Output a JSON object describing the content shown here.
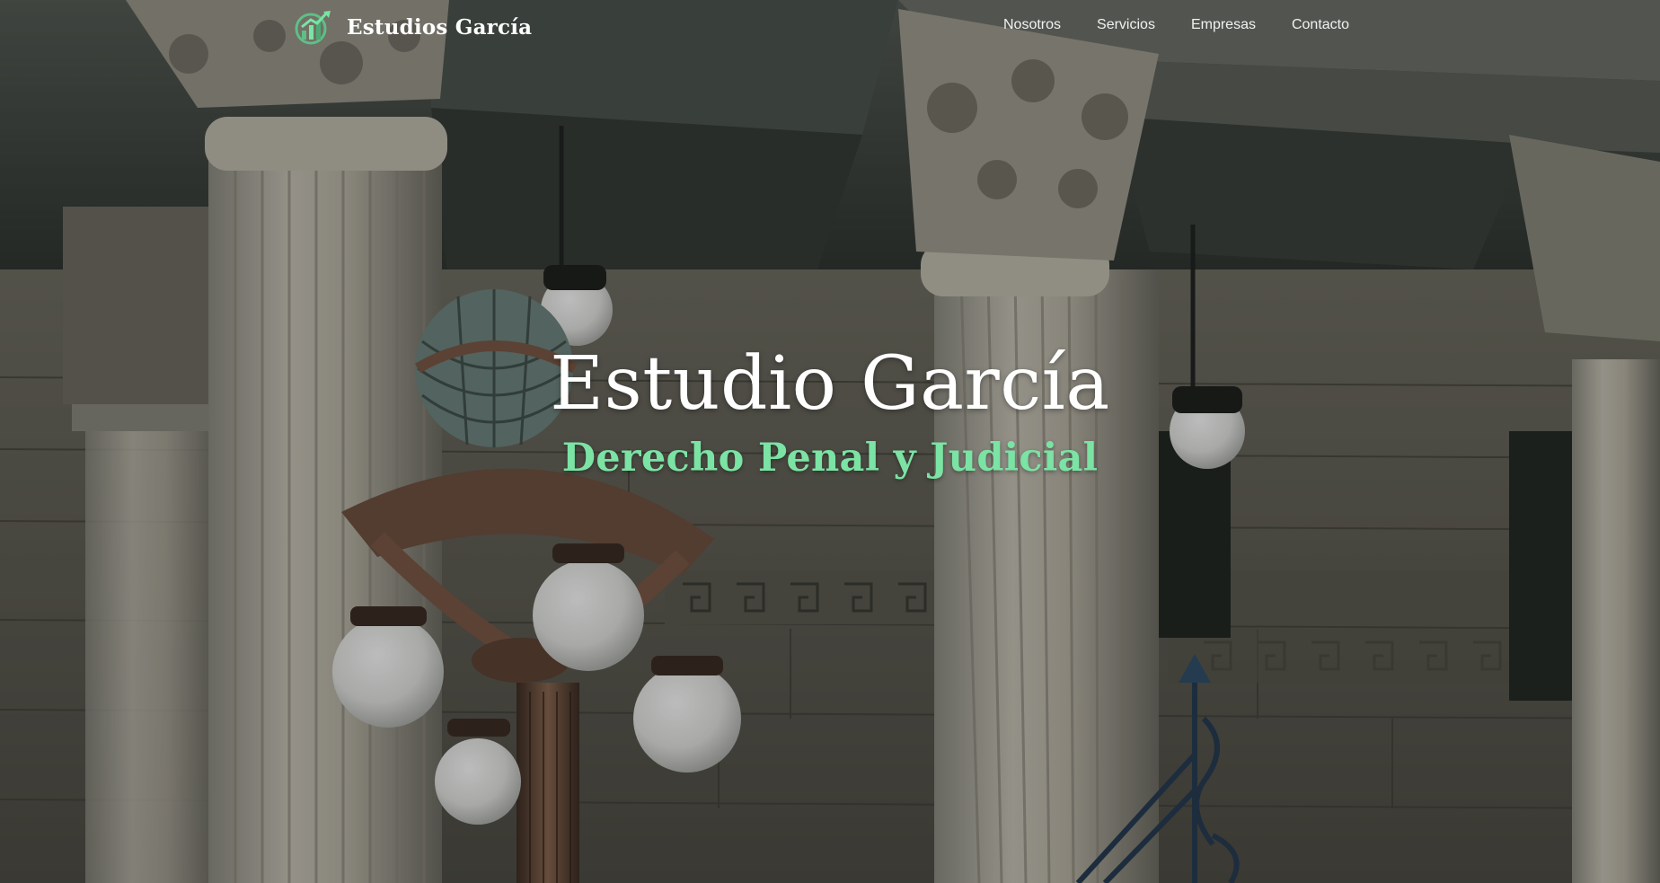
{
  "nav": {
    "brand_name": "Estudios García",
    "brand_icon": "growth-chart-icon",
    "links": [
      "Nosotros",
      "Servicios",
      "Empresas",
      "Contacto"
    ]
  },
  "hero": {
    "title": "Estudio García",
    "subtitle": "Derecho Penal y Judicial",
    "background_image": "neoclassical-columns-street-lamp"
  },
  "colors": {
    "accent": "#7be3a4",
    "text": "#ffffff"
  }
}
